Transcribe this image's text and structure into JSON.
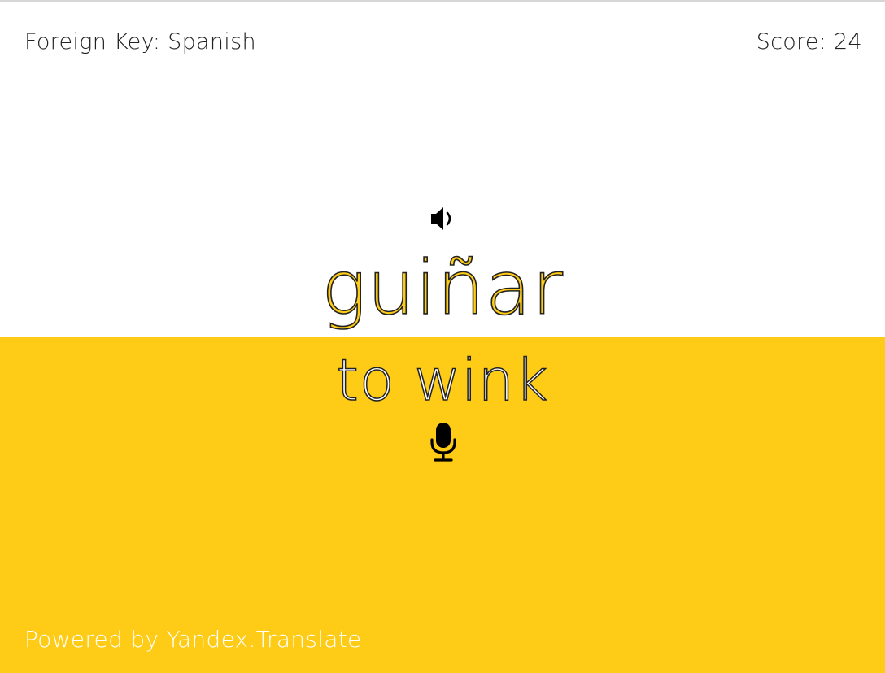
{
  "header": {
    "language_label": "Foreign Key: Spanish",
    "score_label": "Score: 24"
  },
  "card": {
    "foreign_word": "guiñar",
    "native_word": "to wink",
    "play_audio_icon": "speaker-icon",
    "record_icon": "microphone-icon"
  },
  "footer": {
    "credit": "Powered by Yandex.Translate"
  },
  "colors": {
    "accent": "#fecb16",
    "background_top": "#ffffff",
    "text_dark": "#222222",
    "text_light": "#ffffff"
  }
}
